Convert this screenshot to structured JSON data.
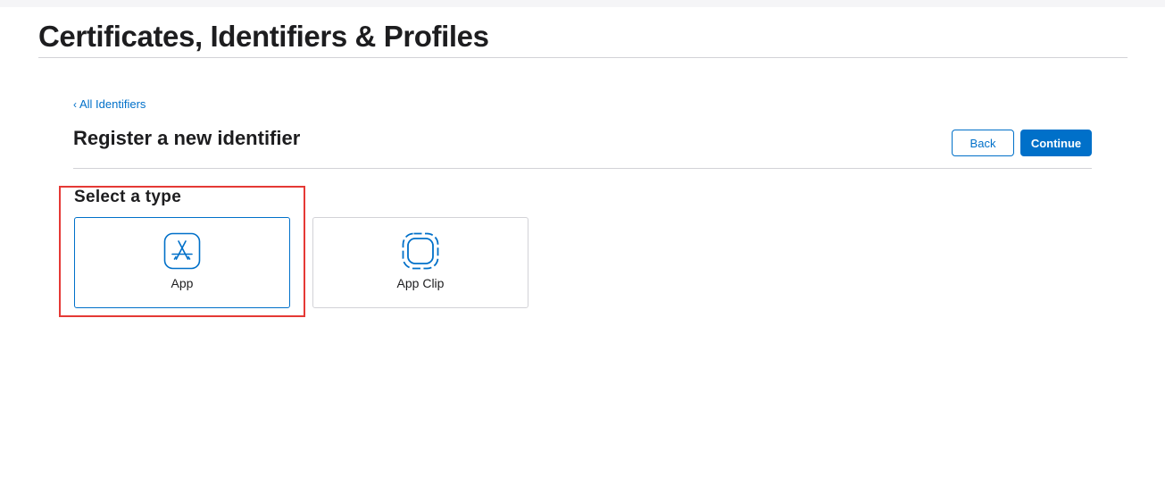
{
  "header": {
    "title": "Certificates, Identifiers & Profiles"
  },
  "nav": {
    "back_link": "All Identifiers",
    "back_chevron": "‹"
  },
  "form": {
    "title": "Register a new identifier",
    "back_label": "Back",
    "continue_label": "Continue"
  },
  "type_selection": {
    "heading": "Select a type",
    "selected": "App",
    "options": [
      {
        "label": "App",
        "icon": "app-store-icon"
      },
      {
        "label": "App Clip",
        "icon": "app-clip-icon"
      }
    ]
  },
  "colors": {
    "accent": "#0070c9",
    "text": "#1d1d1f",
    "divider": "#d2d2d7",
    "annotation": "#e53935"
  }
}
